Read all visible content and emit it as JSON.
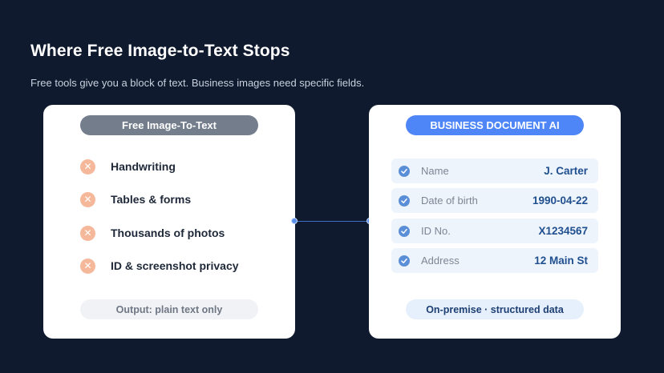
{
  "header": {
    "title": "Where Free Image-to-Text Stops",
    "subtitle": "Free tools give you a block of text. Business images need specific fields."
  },
  "left_card": {
    "badge": "Free Image-To-Text",
    "items": [
      {
        "label": "Handwriting",
        "icon": "x-icon"
      },
      {
        "label": "Tables & forms",
        "icon": "x-icon"
      },
      {
        "label": "Thousands of photos",
        "icon": "x-icon"
      },
      {
        "label": "ID & screenshot privacy",
        "icon": "x-icon"
      }
    ],
    "footer": "Output: plain text only"
  },
  "right_card": {
    "badge": "BUSINESS DOCUMENT AI",
    "fields": [
      {
        "label": "Name",
        "value": "J. Carter",
        "icon": "check-icon"
      },
      {
        "label": "Date of birth",
        "value": "1990-04-22",
        "icon": "check-icon"
      },
      {
        "label": "ID No.",
        "value": "X1234567",
        "icon": "check-icon"
      },
      {
        "label": "Address",
        "value": "12 Main St",
        "icon": "check-icon"
      }
    ],
    "footer": "On-premise · structured data"
  },
  "colors": {
    "background": "#0f1a2e",
    "accent_blue": "#4f86f7",
    "badge_gray": "#737d8c",
    "x_icon": "#f6b89a",
    "field_value": "#1f4f8f"
  }
}
